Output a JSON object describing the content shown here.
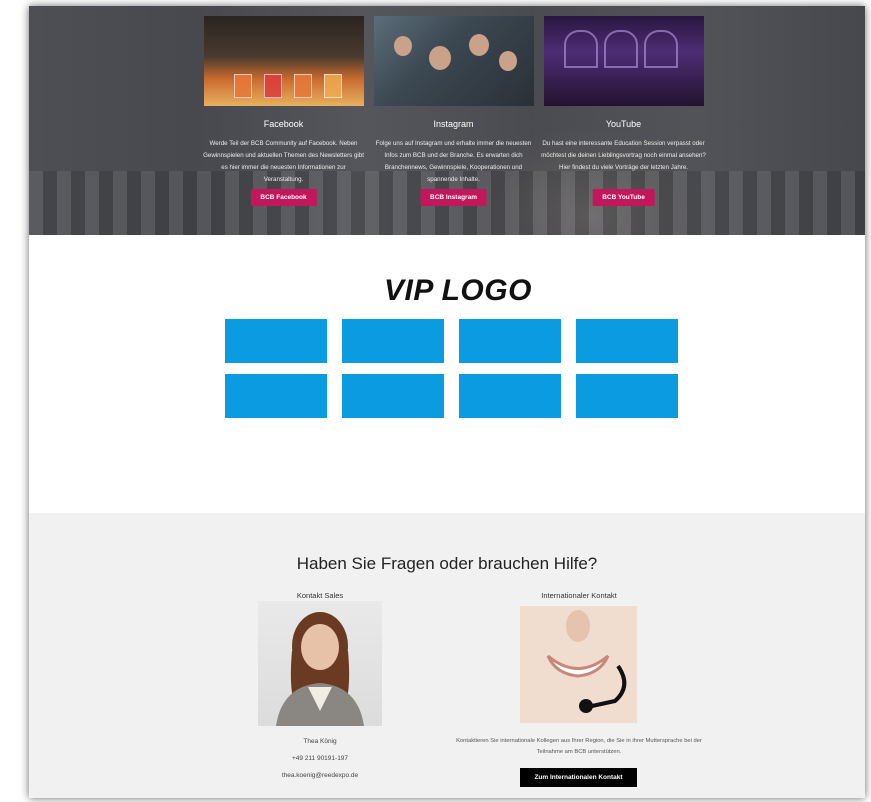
{
  "social": [
    {
      "title": "Facebook",
      "text": "Werde Teil der BCB Community auf Facebook. Neben Gewinnspielen und aktuellen Themen des Newsletters gibt es hier immer die neuesten Informationen zur Veranstaltung.",
      "button": "BCB Facebook"
    },
    {
      "title": "Instagram",
      "text": "Folge uns auf Instagram und erhalte immer die neuesten Infos zum BCB und der Branche. Es erwarten dich Branchennews, Gewinnspiele, Kooperationen und spannende Inhalte.",
      "button": "BCB Instagram"
    },
    {
      "title": "YouTube",
      "text": "Du hast eine interessante Education Session verpasst oder möchtest die deinen Lieblingsvortrag noch einmal ansehen? Hier findest du viele Vorträge der letzten Jahre.",
      "button": "BCB YouTube"
    }
  ],
  "vip": {
    "title": "VIP LOGO",
    "tile_color": "#0b9be0",
    "tile_count": 8
  },
  "contact": {
    "heading": "Haben Sie Fragen oder brauchen Hilfe?",
    "sales": {
      "label": "Kontakt Sales",
      "name": "Thea König",
      "phone": "+49 211 90191-197",
      "email": "thea.koenig@reedexpo.de"
    },
    "international": {
      "label": "Internationaler Kontakt",
      "text": "Kontaktieren Sie internationale Kollegen aus Ihrer Region, die Sie in ihrer Muttersprache bei der Teilnahme am BCB unterstützen.",
      "button": "Zum Internationalen Kontakt"
    }
  },
  "colors": {
    "accent": "#c2185b",
    "vip_blue": "#0b9be0",
    "button_dark": "#000000"
  }
}
